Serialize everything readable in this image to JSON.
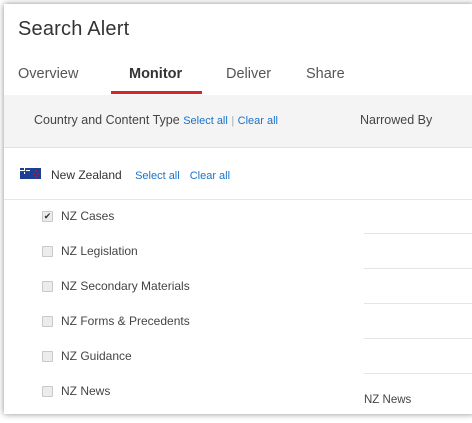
{
  "title": "Search Alert",
  "tabs": [
    {
      "label": "Overview"
    },
    {
      "label": "Monitor"
    },
    {
      "label": "Deliver"
    },
    {
      "label": "Share"
    }
  ],
  "header": {
    "label": "Country and Content Type",
    "select_all": "Select all",
    "separator": "|",
    "clear_all": "Clear all",
    "narrowed_by": "Narrowed By"
  },
  "country": {
    "name": "New Zealand",
    "select_all": "Select all",
    "clear_all": "Clear all"
  },
  "content_types": [
    {
      "label": "NZ Cases",
      "checked": true
    },
    {
      "label": "NZ Legislation",
      "checked": false
    },
    {
      "label": "NZ Secondary Materials",
      "checked": false
    },
    {
      "label": "NZ Forms & Precedents",
      "checked": false
    },
    {
      "label": "NZ Guidance",
      "checked": false
    },
    {
      "label": "NZ News",
      "checked": false
    }
  ],
  "narrowed_items": [
    "NZ News"
  ],
  "colors": {
    "accent": "#d9222a",
    "link": "#1a73c8"
  }
}
